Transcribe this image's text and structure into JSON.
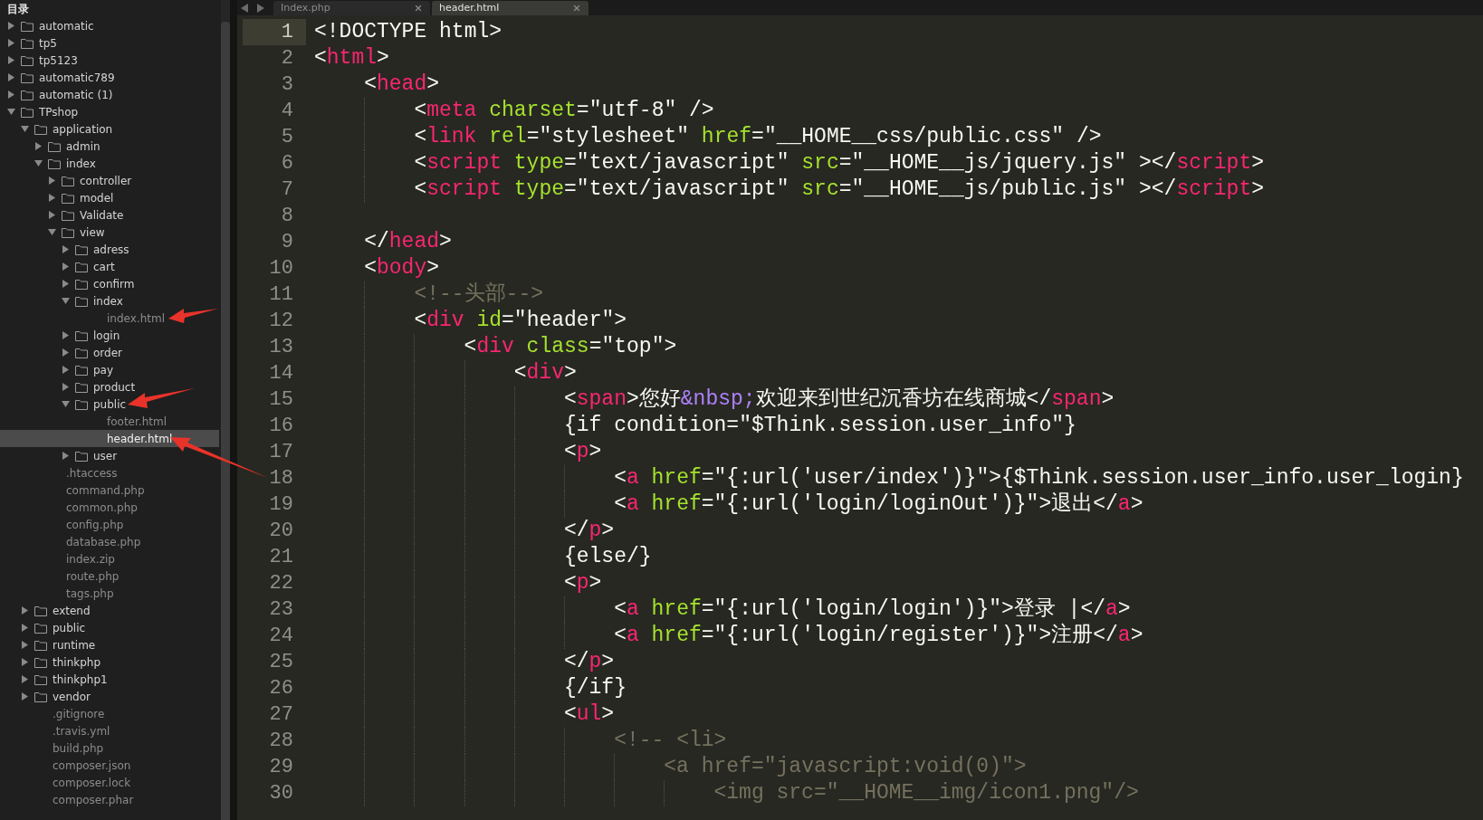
{
  "sidebar": {
    "title": "目录",
    "items": [
      {
        "kind": "folder",
        "name": "automatic",
        "expanded": false,
        "selected": false
      },
      {
        "kind": "folder",
        "name": "tp5",
        "expanded": false,
        "selected": false
      },
      {
        "kind": "folder",
        "name": "tp5123",
        "expanded": false,
        "selected": false
      },
      {
        "kind": "folder",
        "name": "automatic789",
        "expanded": false,
        "selected": false
      },
      {
        "kind": "folder",
        "name": "automatic (1)",
        "expanded": false,
        "selected": false
      },
      {
        "kind": "folder",
        "name": "TPshop",
        "expanded": true,
        "selected": false,
        "children": [
          {
            "kind": "folder",
            "name": "application",
            "expanded": true,
            "selected": false,
            "children": [
              {
                "kind": "folder",
                "name": "admin",
                "expanded": false,
                "selected": false
              },
              {
                "kind": "folder",
                "name": "index",
                "expanded": true,
                "selected": false,
                "children": [
                  {
                    "kind": "folder",
                    "name": "controller",
                    "expanded": false,
                    "selected": false
                  },
                  {
                    "kind": "folder",
                    "name": "model",
                    "expanded": false,
                    "selected": false
                  },
                  {
                    "kind": "folder",
                    "name": "Validate",
                    "expanded": false,
                    "selected": false
                  },
                  {
                    "kind": "folder",
                    "name": "view",
                    "expanded": true,
                    "selected": false,
                    "children": [
                      {
                        "kind": "folder",
                        "name": "adress",
                        "expanded": false,
                        "selected": false
                      },
                      {
                        "kind": "folder",
                        "name": "cart",
                        "expanded": false,
                        "selected": false
                      },
                      {
                        "kind": "folder",
                        "name": "confirm",
                        "expanded": false,
                        "selected": false
                      },
                      {
                        "kind": "folder",
                        "name": "index",
                        "expanded": true,
                        "selected": false,
                        "children": [
                          {
                            "kind": "file",
                            "name": "index.html",
                            "selected": false
                          }
                        ]
                      },
                      {
                        "kind": "folder",
                        "name": "login",
                        "expanded": false,
                        "selected": false
                      },
                      {
                        "kind": "folder",
                        "name": "order",
                        "expanded": false,
                        "selected": false
                      },
                      {
                        "kind": "folder",
                        "name": "pay",
                        "expanded": false,
                        "selected": false
                      },
                      {
                        "kind": "folder",
                        "name": "product",
                        "expanded": false,
                        "selected": false
                      },
                      {
                        "kind": "folder",
                        "name": "public",
                        "expanded": true,
                        "selected": false,
                        "children": [
                          {
                            "kind": "file",
                            "name": "footer.html",
                            "selected": false
                          },
                          {
                            "kind": "file",
                            "name": "header.html",
                            "selected": true
                          }
                        ]
                      },
                      {
                        "kind": "folder",
                        "name": "user",
                        "expanded": false,
                        "selected": false
                      }
                    ]
                  }
                ]
              },
              {
                "kind": "file",
                "name": ".htaccess",
                "selected": false
              },
              {
                "kind": "file",
                "name": "command.php",
                "selected": false
              },
              {
                "kind": "file",
                "name": "common.php",
                "selected": false
              },
              {
                "kind": "file",
                "name": "config.php",
                "selected": false
              },
              {
                "kind": "file",
                "name": "database.php",
                "selected": false
              },
              {
                "kind": "file",
                "name": "index.zip",
                "selected": false
              },
              {
                "kind": "file",
                "name": "route.php",
                "selected": false
              },
              {
                "kind": "file",
                "name": "tags.php",
                "selected": false
              }
            ]
          },
          {
            "kind": "folder",
            "name": "extend",
            "expanded": false,
            "selected": false
          },
          {
            "kind": "folder",
            "name": "public",
            "expanded": false,
            "selected": false
          },
          {
            "kind": "folder",
            "name": "runtime",
            "expanded": false,
            "selected": false
          },
          {
            "kind": "folder",
            "name": "thinkphp",
            "expanded": false,
            "selected": false
          },
          {
            "kind": "folder",
            "name": "thinkphp1",
            "expanded": false,
            "selected": false
          },
          {
            "kind": "folder",
            "name": "vendor",
            "expanded": false,
            "selected": false
          },
          {
            "kind": "file",
            "name": ".gitignore",
            "selected": false
          },
          {
            "kind": "file",
            "name": ".travis.yml",
            "selected": false
          },
          {
            "kind": "file",
            "name": "build.php",
            "selected": false
          },
          {
            "kind": "file",
            "name": "composer.json",
            "selected": false
          },
          {
            "kind": "file",
            "name": "composer.lock",
            "selected": false
          },
          {
            "kind": "file",
            "name": "composer.phar",
            "selected": false
          }
        ]
      }
    ]
  },
  "tabs": [
    {
      "label": "Index.php",
      "selected": false
    },
    {
      "label": "header.html",
      "selected": true
    }
  ],
  "editor": {
    "lines": [
      {
        "number": "1",
        "current": true,
        "tokens": [
          {
            "kind": "text",
            "text": "<!DOCTYPE html>"
          }
        ]
      },
      {
        "number": "2",
        "current": false,
        "tokens": [
          {
            "kind": "text",
            "text": "<"
          },
          {
            "kind": "tag",
            "text": "html"
          },
          {
            "kind": "text",
            "text": ">"
          }
        ]
      },
      {
        "number": "3",
        "current": false,
        "tokens": [
          {
            "kind": "text",
            "text": "    <"
          },
          {
            "kind": "tag",
            "text": "head"
          },
          {
            "kind": "text",
            "text": ">"
          }
        ]
      },
      {
        "number": "4",
        "current": false,
        "tokens": [
          {
            "kind": "text",
            "text": "        <"
          },
          {
            "kind": "tag",
            "text": "meta"
          },
          {
            "kind": "attr",
            "text": " charset"
          },
          {
            "kind": "text",
            "text": "=\"utf-8\" />"
          }
        ]
      },
      {
        "number": "5",
        "current": false,
        "tokens": [
          {
            "kind": "text",
            "text": "        <"
          },
          {
            "kind": "tag",
            "text": "link"
          },
          {
            "kind": "attr",
            "text": " rel"
          },
          {
            "kind": "text",
            "text": "=\"stylesheet\" "
          },
          {
            "kind": "attr",
            "text": "href"
          },
          {
            "kind": "text",
            "text": "=\"__HOME__css/public.css\" />"
          }
        ]
      },
      {
        "number": "6",
        "current": false,
        "tokens": [
          {
            "kind": "text",
            "text": "        <"
          },
          {
            "kind": "tag",
            "text": "script"
          },
          {
            "kind": "attr",
            "text": " type"
          },
          {
            "kind": "text",
            "text": "=\"text/javascript\" "
          },
          {
            "kind": "attr",
            "text": "src"
          },
          {
            "kind": "text",
            "text": "=\"__HOME__js/jquery.js\" ></"
          },
          {
            "kind": "tag",
            "text": "script"
          },
          {
            "kind": "text",
            "text": ">"
          }
        ]
      },
      {
        "number": "7",
        "current": false,
        "tokens": [
          {
            "kind": "text",
            "text": "        <"
          },
          {
            "kind": "tag",
            "text": "script"
          },
          {
            "kind": "attr",
            "text": " type"
          },
          {
            "kind": "text",
            "text": "=\"text/javascript\" "
          },
          {
            "kind": "attr",
            "text": "src"
          },
          {
            "kind": "text",
            "text": "=\"__HOME__js/public.js\" ></"
          },
          {
            "kind": "tag",
            "text": "script"
          },
          {
            "kind": "text",
            "text": ">"
          }
        ]
      },
      {
        "number": "8",
        "current": false
      },
      {
        "number": "9",
        "current": false,
        "tokens": [
          {
            "kind": "text",
            "text": "    </"
          },
          {
            "kind": "tag",
            "text": "head"
          },
          {
            "kind": "text",
            "text": ">"
          }
        ]
      },
      {
        "number": "10",
        "current": false,
        "tokens": [
          {
            "kind": "text",
            "text": "    <"
          },
          {
            "kind": "tag",
            "text": "body"
          },
          {
            "kind": "text",
            "text": ">"
          }
        ]
      },
      {
        "number": "11",
        "current": false,
        "tokens": [
          {
            "kind": "comment",
            "text": "        <!--头部-->"
          }
        ]
      },
      {
        "number": "12",
        "current": false,
        "tokens": [
          {
            "kind": "text",
            "text": "        <"
          },
          {
            "kind": "tag",
            "text": "div"
          },
          {
            "kind": "attr",
            "text": " id"
          },
          {
            "kind": "text",
            "text": "=\"header\">"
          }
        ]
      },
      {
        "number": "13",
        "current": false,
        "tokens": [
          {
            "kind": "text",
            "text": "            <"
          },
          {
            "kind": "tag",
            "text": "div"
          },
          {
            "kind": "attr",
            "text": " class"
          },
          {
            "kind": "text",
            "text": "=\"top\">"
          }
        ]
      },
      {
        "number": "14",
        "current": false,
        "tokens": [
          {
            "kind": "text",
            "text": "                <"
          },
          {
            "kind": "tag",
            "text": "div"
          },
          {
            "kind": "text",
            "text": ">"
          }
        ]
      },
      {
        "number": "15",
        "current": false,
        "tokens": [
          {
            "kind": "text",
            "text": "                    <"
          },
          {
            "kind": "tag",
            "text": "span"
          },
          {
            "kind": "text",
            "text": ">您好"
          },
          {
            "kind": "entity",
            "text": "&nbsp;"
          },
          {
            "kind": "text",
            "text": "欢迎来到世纪沉香坊在线商城</"
          },
          {
            "kind": "tag",
            "text": "span"
          },
          {
            "kind": "text",
            "text": ">"
          }
        ]
      },
      {
        "number": "16",
        "current": false,
        "tokens": [
          {
            "kind": "text",
            "text": "                    {if condition=\"$Think.session.user_info\"}"
          }
        ]
      },
      {
        "number": "17",
        "current": false,
        "tokens": [
          {
            "kind": "text",
            "text": "                    <"
          },
          {
            "kind": "tag",
            "text": "p"
          },
          {
            "kind": "text",
            "text": ">"
          }
        ]
      },
      {
        "number": "18",
        "current": false,
        "tokens": [
          {
            "kind": "text",
            "text": "                        <"
          },
          {
            "kind": "tag",
            "text": "a"
          },
          {
            "kind": "attr",
            "text": " href"
          },
          {
            "kind": "text",
            "text": "=\"{:url('user/index')}\">{$Think.session.user_info.user_login}"
          }
        ]
      },
      {
        "number": "19",
        "current": false,
        "tokens": [
          {
            "kind": "text",
            "text": "                        <"
          },
          {
            "kind": "tag",
            "text": "a"
          },
          {
            "kind": "attr",
            "text": " href"
          },
          {
            "kind": "text",
            "text": "=\"{:url('login/loginOut')}\">退出</"
          },
          {
            "kind": "tag",
            "text": "a"
          },
          {
            "kind": "text",
            "text": ">"
          }
        ]
      },
      {
        "number": "20",
        "current": false,
        "tokens": [
          {
            "kind": "text",
            "text": "                    </"
          },
          {
            "kind": "tag",
            "text": "p"
          },
          {
            "kind": "text",
            "text": ">"
          }
        ]
      },
      {
        "number": "21",
        "current": false,
        "tokens": [
          {
            "kind": "text",
            "text": "                    {else/}"
          }
        ]
      },
      {
        "number": "22",
        "current": false,
        "tokens": [
          {
            "kind": "text",
            "text": "                    <"
          },
          {
            "kind": "tag",
            "text": "p"
          },
          {
            "kind": "text",
            "text": ">"
          }
        ]
      },
      {
        "number": "23",
        "current": false,
        "tokens": [
          {
            "kind": "text",
            "text": "                        <"
          },
          {
            "kind": "tag",
            "text": "a"
          },
          {
            "kind": "attr",
            "text": " href"
          },
          {
            "kind": "text",
            "text": "=\"{:url('login/login')}\">登录 |</"
          },
          {
            "kind": "tag",
            "text": "a"
          },
          {
            "kind": "text",
            "text": ">"
          }
        ]
      },
      {
        "number": "24",
        "current": false,
        "tokens": [
          {
            "kind": "text",
            "text": "                        <"
          },
          {
            "kind": "tag",
            "text": "a"
          },
          {
            "kind": "attr",
            "text": " href"
          },
          {
            "kind": "text",
            "text": "=\"{:url('login/register')}\">注册</"
          },
          {
            "kind": "tag",
            "text": "a"
          },
          {
            "kind": "text",
            "text": ">"
          }
        ]
      },
      {
        "number": "25",
        "current": false,
        "tokens": [
          {
            "kind": "text",
            "text": "                    </"
          },
          {
            "kind": "tag",
            "text": "p"
          },
          {
            "kind": "text",
            "text": ">"
          }
        ]
      },
      {
        "number": "26",
        "current": false,
        "tokens": [
          {
            "kind": "text",
            "text": "                    {/if}"
          }
        ]
      },
      {
        "number": "27",
        "current": false,
        "tokens": [
          {
            "kind": "text",
            "text": "                    <"
          },
          {
            "kind": "tag",
            "text": "ul"
          },
          {
            "kind": "text",
            "text": ">"
          }
        ]
      },
      {
        "number": "28",
        "current": false,
        "tokens": [
          {
            "kind": "comment",
            "text": "                        <!-- <li>"
          }
        ]
      },
      {
        "number": "29",
        "current": false,
        "tokens": [
          {
            "kind": "comment",
            "text": "                            <a href=\"javascript:void(0)\">"
          }
        ]
      },
      {
        "number": "30",
        "current": false,
        "tokens": [
          {
            "kind": "comment",
            "text": "                                <img src=\"__HOME__img/icon1.png\"/>"
          }
        ]
      }
    ]
  }
}
